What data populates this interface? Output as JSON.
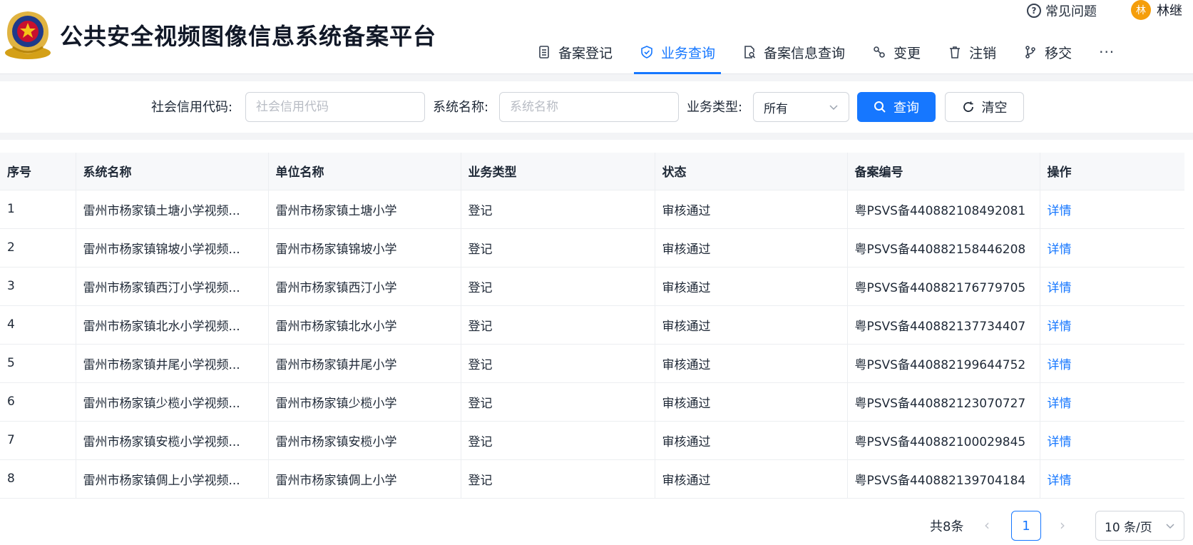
{
  "header": {
    "title": "公共安全视频图像信息系统备案平台",
    "faq_label": "常见问题",
    "user_initial": "林",
    "user_name": "林继"
  },
  "nav": {
    "items": [
      {
        "label": "备案登记",
        "icon": "list-doc-icon"
      },
      {
        "label": "业务查询",
        "icon": "shield-check-icon",
        "active": true
      },
      {
        "label": "备案信息查询",
        "icon": "doc-search-icon"
      },
      {
        "label": "变更",
        "icon": "link-icon"
      },
      {
        "label": "注销",
        "icon": "trash-icon"
      },
      {
        "label": "移交",
        "icon": "branch-icon"
      }
    ],
    "more": "···"
  },
  "filters": {
    "credit_code_label": "社会信用代码:",
    "credit_code_placeholder": "社会信用代码",
    "system_name_label": "系统名称:",
    "system_name_placeholder": "系统名称",
    "business_type_label": "业务类型:",
    "business_type_value": "所有",
    "search_label": "查询",
    "clear_label": "清空"
  },
  "table": {
    "columns": [
      "序号",
      "系统名称",
      "单位名称",
      "业务类型",
      "状态",
      "备案编号",
      "操作"
    ],
    "rows": [
      [
        "1",
        "雷州市杨家镇土塘小学视频...",
        "雷州市杨家镇土塘小学",
        "登记",
        "审核通过",
        "粤PSVS备440882108492081",
        "详情"
      ],
      [
        "2",
        "雷州市杨家镇锦坡小学视频...",
        "雷州市杨家镇锦坡小学",
        "登记",
        "审核通过",
        "粤PSVS备440882158446208",
        "详情"
      ],
      [
        "3",
        "雷州市杨家镇西汀小学视频...",
        "雷州市杨家镇西汀小学",
        "登记",
        "审核通过",
        "粤PSVS备440882176779705",
        "详情"
      ],
      [
        "4",
        "雷州市杨家镇北水小学视频...",
        "雷州市杨家镇北水小学",
        "登记",
        "审核通过",
        "粤PSVS备440882137734407",
        "详情"
      ],
      [
        "5",
        "雷州市杨家镇井尾小学视频...",
        "雷州市杨家镇井尾小学",
        "登记",
        "审核通过",
        "粤PSVS备440882199644752",
        "详情"
      ],
      [
        "6",
        "雷州市杨家镇少榄小学视频...",
        "雷州市杨家镇少榄小学",
        "登记",
        "审核通过",
        "粤PSVS备440882123070727",
        "详情"
      ],
      [
        "7",
        "雷州市杨家镇安榄小学视频...",
        "雷州市杨家镇安榄小学",
        "登记",
        "审核通过",
        "粤PSVS备440882100029845",
        "详情"
      ],
      [
        "8",
        "雷州市杨家镇倜上小学视频...",
        "雷州市杨家镇倜上小学",
        "登记",
        "审核通过",
        "粤PSVS备440882139704184",
        "详情"
      ]
    ]
  },
  "pagination": {
    "total": "共8条",
    "current_page": "1",
    "page_size": "10 条/页"
  },
  "colors": {
    "accent": "#1677ff",
    "avatar": "#f59e0b"
  }
}
